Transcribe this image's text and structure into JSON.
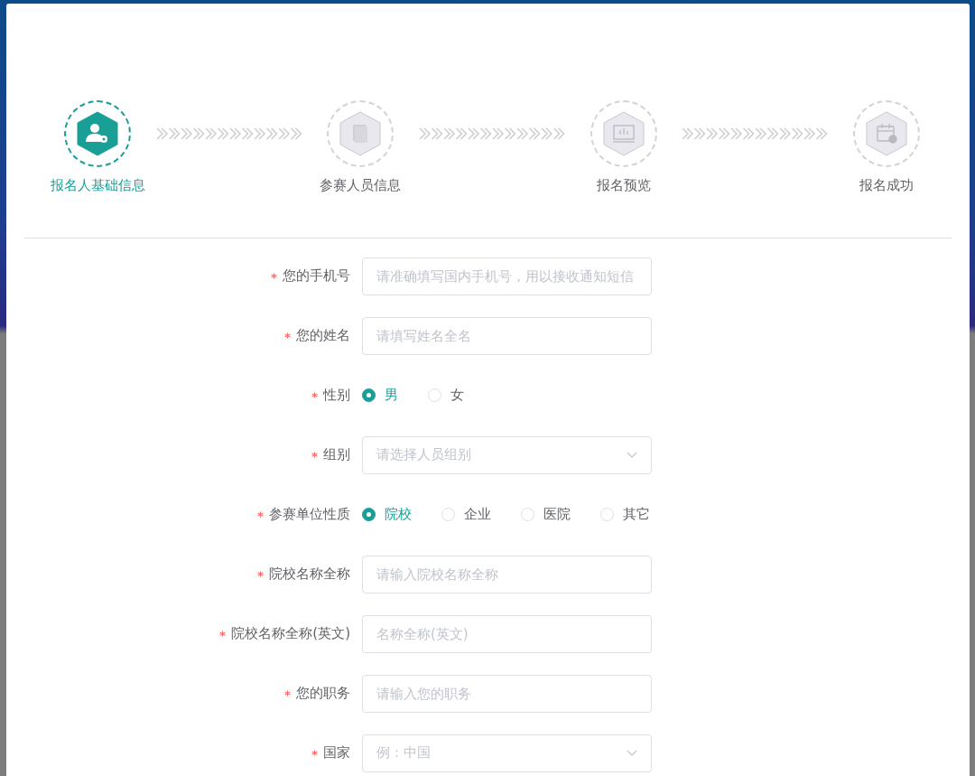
{
  "steps": [
    {
      "label": "报名人基础信息",
      "active": true
    },
    {
      "label": "参赛人员信息",
      "active": false
    },
    {
      "label": "报名预览",
      "active": false
    },
    {
      "label": "报名成功",
      "active": false
    }
  ],
  "form": {
    "fields": [
      {
        "kind": "input",
        "label": "您的手机号",
        "required": true,
        "placeholder": "请准确填写国内手机号，用以接收通知短信"
      },
      {
        "kind": "input",
        "label": "您的姓名",
        "required": true,
        "placeholder": "请填写姓名全名"
      },
      {
        "kind": "radio",
        "label": "性别",
        "required": true,
        "options": [
          {
            "label": "男",
            "selected": true
          },
          {
            "label": "女",
            "selected": false
          }
        ]
      },
      {
        "kind": "select",
        "label": "组别",
        "required": true,
        "placeholder": "请选择人员组别"
      },
      {
        "kind": "radio",
        "label": "参赛单位性质",
        "required": true,
        "options": [
          {
            "label": "院校",
            "selected": true
          },
          {
            "label": "企业",
            "selected": false
          },
          {
            "label": "医院",
            "selected": false
          },
          {
            "label": "其它",
            "selected": false
          }
        ]
      },
      {
        "kind": "input",
        "label": "院校名称全称",
        "required": true,
        "placeholder": "请输入院校名称全称"
      },
      {
        "kind": "input",
        "label": "院校名称全称(英文)",
        "required": true,
        "placeholder": "名称全称(英文)"
      },
      {
        "kind": "input",
        "label": "您的职务",
        "required": true,
        "placeholder": "请输入您的职务"
      },
      {
        "kind": "select",
        "label": "国家",
        "required": true,
        "placeholder": "例：中国"
      }
    ]
  }
}
